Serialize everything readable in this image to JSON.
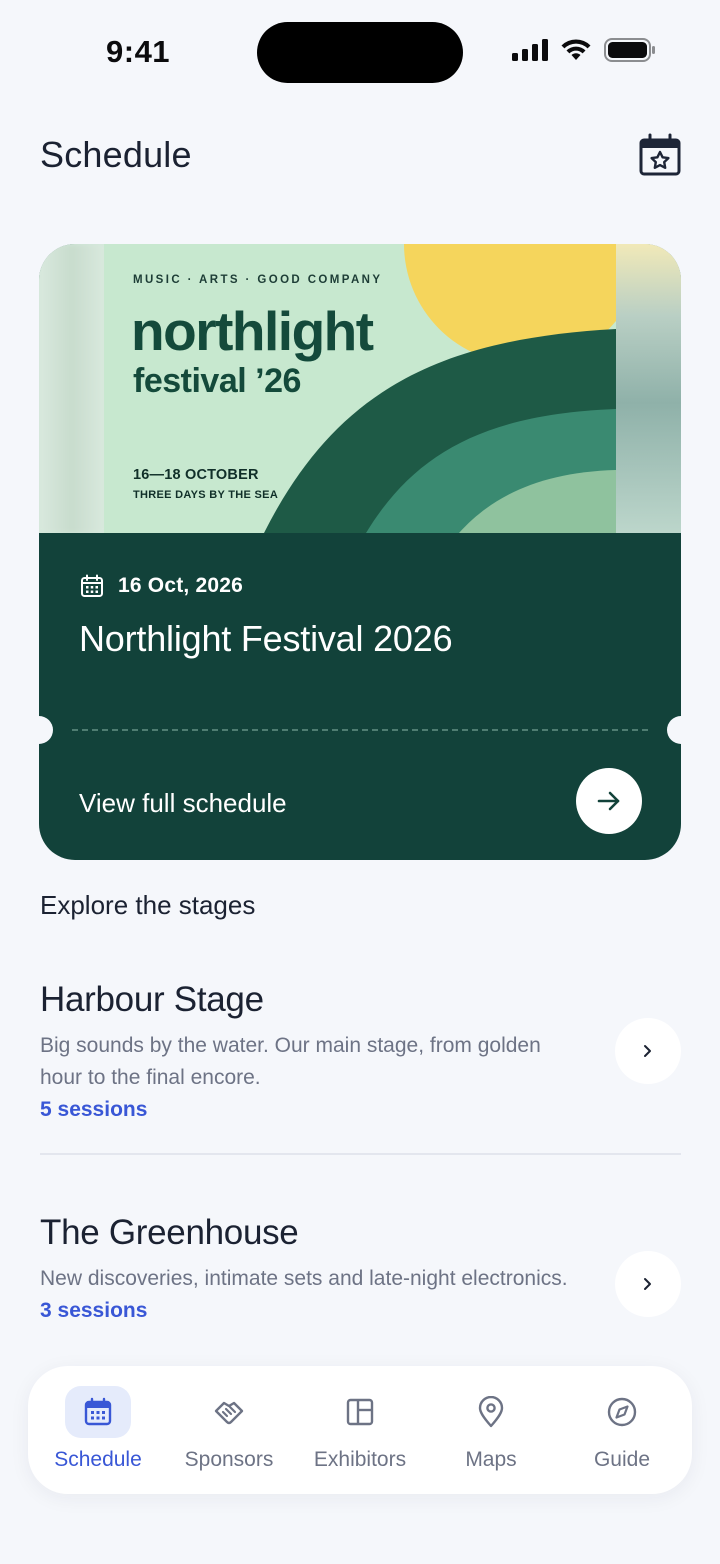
{
  "status_bar": {
    "time": "9:41"
  },
  "header": {
    "title": "Schedule",
    "calendar_icon": "calendar-star-icon"
  },
  "event": {
    "poster": {
      "tag": "MUSIC · ARTS · GOOD COMPANY",
      "brand": "northlight",
      "subtitle": "festival ’26",
      "dates": "16—18 OCTOBER",
      "tagline": "THREE DAYS BY THE SEA"
    },
    "date": "16 Oct, 2026",
    "title": "Northlight Festival 2026",
    "cta": "View full schedule",
    "colors": {
      "card": "#12423a",
      "poster_bg": "#c7e8cf",
      "sun": "#f5d55c"
    }
  },
  "stages_section": {
    "title": "Explore the stages",
    "items": [
      {
        "name": "Harbour Stage",
        "description": "Big sounds by the water. Our main stage, from golden hour to the final encore.",
        "count": "5 sessions"
      },
      {
        "name": "The Greenhouse",
        "description": "New discoveries, intimate sets and late-night electronics.",
        "count": "3 sessions"
      }
    ]
  },
  "nav": {
    "items": [
      {
        "label": "Schedule",
        "icon": "calendar-icon",
        "active": true
      },
      {
        "label": "Sponsors",
        "icon": "handshake-icon",
        "active": false
      },
      {
        "label": "Exhibitors",
        "icon": "layout-icon",
        "active": false
      },
      {
        "label": "Maps",
        "icon": "map-pin-icon",
        "active": false
      },
      {
        "label": "Guide",
        "icon": "compass-icon",
        "active": false
      }
    ],
    "accent": "#3957d6"
  }
}
